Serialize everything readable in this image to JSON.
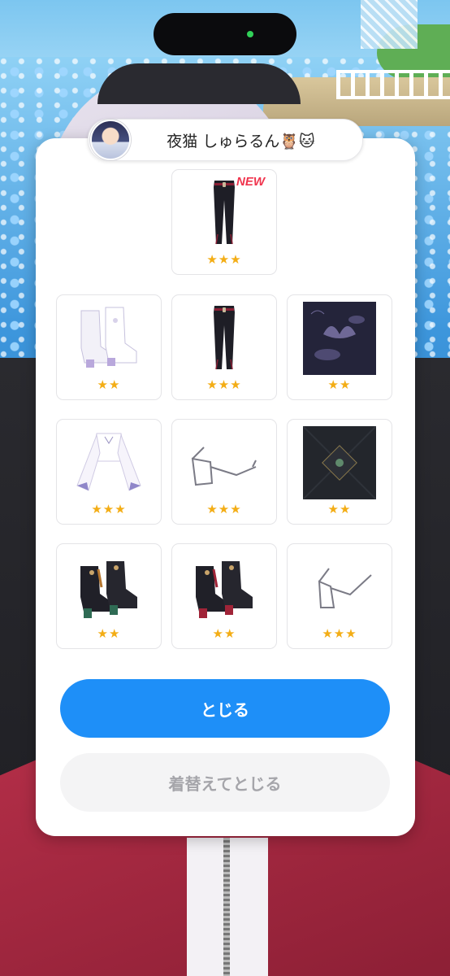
{
  "sender": {
    "name": "夜猫 しゅらるん🦉🐱"
  },
  "featured_item": {
    "badge": "NEW",
    "stars": "★★★",
    "icon": "black-pants"
  },
  "items": [
    {
      "icon": "white-boots",
      "stars": "★★"
    },
    {
      "icon": "black-pants",
      "stars": "★★★"
    },
    {
      "icon": "lotus-pattern-tile",
      "stars": "★★"
    },
    {
      "icon": "white-blouse",
      "stars": "★★★"
    },
    {
      "icon": "glasses",
      "stars": "★★★"
    },
    {
      "icon": "dark-floor-tile",
      "stars": "★★"
    },
    {
      "icon": "black-green-boots",
      "stars": "★★"
    },
    {
      "icon": "black-red-boots",
      "stars": "★★"
    },
    {
      "icon": "glasses",
      "stars": "★★★"
    }
  ],
  "buttons": {
    "close": "とじる",
    "change_and_close": "着替えてとじる"
  },
  "colors": {
    "primary": "#1e8ff8",
    "star": "#f3ad15",
    "new_badge": "#f0344d"
  }
}
